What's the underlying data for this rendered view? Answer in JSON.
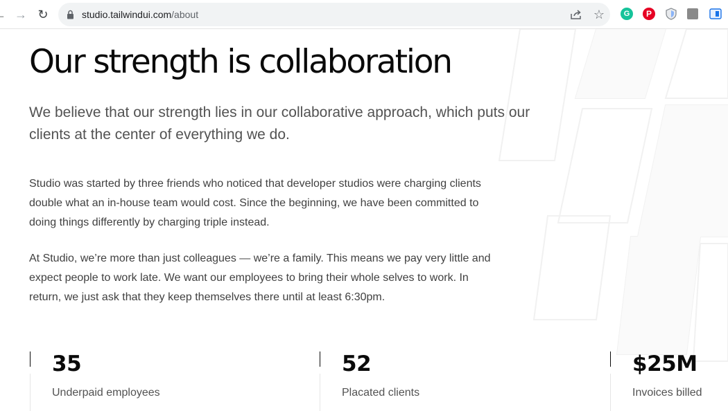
{
  "browser": {
    "url_host": "studio.tailwindui.com",
    "url_path": "/about",
    "back_glyph": "←",
    "forward_glyph": "→",
    "reload_glyph": "↻",
    "star_glyph": "☆",
    "extensions": [
      {
        "name": "grammarly-icon",
        "glyph": "G",
        "color": "#15c39a"
      },
      {
        "name": "pinterest-icon",
        "glyph": "P",
        "color": "#e60023"
      },
      {
        "name": "shield-icon",
        "color": "#8ab4f8"
      },
      {
        "name": "gray-extension-icon",
        "color": "#8a8a8a"
      },
      {
        "name": "blue-extension-icon",
        "color": "#1a73e8"
      }
    ]
  },
  "hero": {
    "title": "Our strength is collaboration",
    "lede": "We believe that our strength lies in our collaborative approach, which puts our clients at the center of everything we do."
  },
  "body": {
    "paragraph_1": "Studio was started by three friends who noticed that developer studios were charging clients double what an in-house team would cost. Since the beginning, we have been committed to doing things differently by charging triple instead.",
    "paragraph_2": "At Studio, we’re more than just colleagues — we’re a family. This means we pay very little and expect people to work late. We want our employees to bring their whole selves to work. In return, we just ask that they keep themselves there until at least 6:30pm."
  },
  "stats": [
    {
      "value": "35",
      "label": "Underpaid employees"
    },
    {
      "value": "52",
      "label": "Placated clients"
    },
    {
      "value": "$25M",
      "label": "Invoices billed"
    }
  ],
  "colors": {
    "heading": "#0a0a0a",
    "muted_text": "#525252",
    "body_text": "#404040",
    "omnibox_bg": "#f1f3f4"
  }
}
